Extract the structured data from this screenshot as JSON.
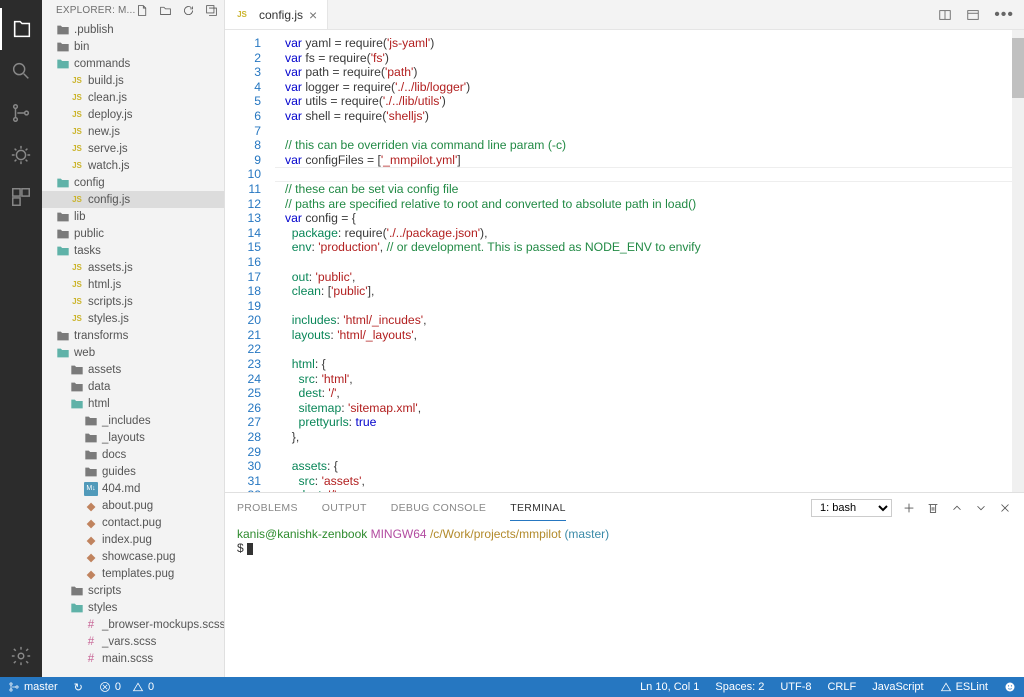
{
  "sidebar": {
    "title": "EXPLORER: M...",
    "tree": [
      {
        "d": 0,
        "t": "folder",
        "open": false,
        "n": ".publish"
      },
      {
        "d": 0,
        "t": "folder",
        "open": false,
        "n": "bin"
      },
      {
        "d": 0,
        "t": "folder",
        "open": true,
        "n": "commands"
      },
      {
        "d": 1,
        "t": "js",
        "n": "build.js"
      },
      {
        "d": 1,
        "t": "js",
        "n": "clean.js"
      },
      {
        "d": 1,
        "t": "js",
        "n": "deploy.js"
      },
      {
        "d": 1,
        "t": "js",
        "n": "new.js"
      },
      {
        "d": 1,
        "t": "js",
        "n": "serve.js"
      },
      {
        "d": 1,
        "t": "js",
        "n": "watch.js"
      },
      {
        "d": 0,
        "t": "folder",
        "open": true,
        "n": "config"
      },
      {
        "d": 1,
        "t": "js",
        "n": "config.js",
        "sel": true
      },
      {
        "d": 0,
        "t": "folder",
        "open": false,
        "n": "lib"
      },
      {
        "d": 0,
        "t": "folder",
        "open": false,
        "n": "public"
      },
      {
        "d": 0,
        "t": "folder",
        "open": true,
        "n": "tasks"
      },
      {
        "d": 1,
        "t": "js",
        "n": "assets.js"
      },
      {
        "d": 1,
        "t": "js",
        "n": "html.js"
      },
      {
        "d": 1,
        "t": "js",
        "n": "scripts.js"
      },
      {
        "d": 1,
        "t": "js",
        "n": "styles.js"
      },
      {
        "d": 0,
        "t": "folder",
        "open": false,
        "n": "transforms"
      },
      {
        "d": 0,
        "t": "folder",
        "open": true,
        "n": "web"
      },
      {
        "d": 1,
        "t": "folder",
        "open": false,
        "n": "assets"
      },
      {
        "d": 1,
        "t": "folder",
        "open": false,
        "n": "data"
      },
      {
        "d": 1,
        "t": "folder",
        "open": true,
        "n": "html"
      },
      {
        "d": 2,
        "t": "folder",
        "open": false,
        "n": "_includes"
      },
      {
        "d": 2,
        "t": "folder",
        "open": false,
        "n": "_layouts"
      },
      {
        "d": 2,
        "t": "folder",
        "open": false,
        "n": "docs"
      },
      {
        "d": 2,
        "t": "folder",
        "open": false,
        "n": "guides"
      },
      {
        "d": 2,
        "t": "md",
        "n": "404.md"
      },
      {
        "d": 2,
        "t": "pug",
        "n": "about.pug"
      },
      {
        "d": 2,
        "t": "pug",
        "n": "contact.pug"
      },
      {
        "d": 2,
        "t": "pug",
        "n": "index.pug"
      },
      {
        "d": 2,
        "t": "pug",
        "n": "showcase.pug"
      },
      {
        "d": 2,
        "t": "pug",
        "n": "templates.pug"
      },
      {
        "d": 1,
        "t": "folder",
        "open": false,
        "n": "scripts"
      },
      {
        "d": 1,
        "t": "folder",
        "open": true,
        "n": "styles"
      },
      {
        "d": 2,
        "t": "scss",
        "n": "_browser-mockups.scss"
      },
      {
        "d": 2,
        "t": "scss",
        "n": "_vars.scss"
      },
      {
        "d": 2,
        "t": "scss",
        "n": "main.scss"
      }
    ]
  },
  "tabs": [
    {
      "icon": "js",
      "name": "config.js"
    }
  ],
  "code": {
    "lines": [
      [
        [
          "k",
          "var"
        ],
        [
          "d",
          " yaml = require("
        ],
        [
          "s",
          "'js-yaml'"
        ],
        [
          "d",
          ")"
        ]
      ],
      [
        [
          "k",
          "var"
        ],
        [
          "d",
          " fs = require("
        ],
        [
          "s",
          "'fs'"
        ],
        [
          "d",
          ")"
        ]
      ],
      [
        [
          "k",
          "var"
        ],
        [
          "d",
          " path = require("
        ],
        [
          "s",
          "'path'"
        ],
        [
          "d",
          ")"
        ]
      ],
      [
        [
          "k",
          "var"
        ],
        [
          "d",
          " logger = require("
        ],
        [
          "s",
          "'./../lib/logger'"
        ],
        [
          "d",
          ")"
        ]
      ],
      [
        [
          "k",
          "var"
        ],
        [
          "d",
          " utils = require("
        ],
        [
          "s",
          "'./../lib/utils'"
        ],
        [
          "d",
          ")"
        ]
      ],
      [
        [
          "k",
          "var"
        ],
        [
          "d",
          " shell = require("
        ],
        [
          "s",
          "'shelljs'"
        ],
        [
          "d",
          ")"
        ]
      ],
      [],
      [
        [
          "c",
          "// this can be overriden via command line param (-c)"
        ]
      ],
      [
        [
          "k",
          "var"
        ],
        [
          "d",
          " configFiles = ["
        ],
        [
          "s",
          "'_mmpilot.yml'"
        ],
        [
          "d",
          "]"
        ]
      ],
      [],
      [
        [
          "c",
          "// these can be set via config file"
        ]
      ],
      [
        [
          "c",
          "// paths are specified relative to root and converted to absolute path in load()"
        ]
      ],
      [
        [
          "k",
          "var"
        ],
        [
          "d",
          " config = {"
        ]
      ],
      [
        [
          "d",
          "  "
        ],
        [
          "p",
          "package"
        ],
        [
          "d",
          ": require("
        ],
        [
          "s",
          "'./../package.json'"
        ],
        [
          "d",
          "),"
        ]
      ],
      [
        [
          "d",
          "  "
        ],
        [
          "p",
          "env"
        ],
        [
          "d",
          ": "
        ],
        [
          "s",
          "'production'"
        ],
        [
          "d",
          ", "
        ],
        [
          "c",
          "// or development. This is passed as NODE_ENV to envify"
        ]
      ],
      [],
      [
        [
          "d",
          "  "
        ],
        [
          "p",
          "out"
        ],
        [
          "d",
          ": "
        ],
        [
          "s",
          "'public'"
        ],
        [
          "d",
          ","
        ]
      ],
      [
        [
          "d",
          "  "
        ],
        [
          "p",
          "clean"
        ],
        [
          "d",
          ": ["
        ],
        [
          "s",
          "'public'"
        ],
        [
          "d",
          "],"
        ]
      ],
      [],
      [
        [
          "d",
          "  "
        ],
        [
          "p",
          "includes"
        ],
        [
          "d",
          ": "
        ],
        [
          "s",
          "'html/_incudes'"
        ],
        [
          "d",
          ","
        ]
      ],
      [
        [
          "d",
          "  "
        ],
        [
          "p",
          "layouts"
        ],
        [
          "d",
          ": "
        ],
        [
          "s",
          "'html/_layouts'"
        ],
        [
          "d",
          ","
        ]
      ],
      [],
      [
        [
          "d",
          "  "
        ],
        [
          "p",
          "html"
        ],
        [
          "d",
          ": {"
        ]
      ],
      [
        [
          "d",
          "    "
        ],
        [
          "p",
          "src"
        ],
        [
          "d",
          ": "
        ],
        [
          "s",
          "'html'"
        ],
        [
          "d",
          ","
        ]
      ],
      [
        [
          "d",
          "    "
        ],
        [
          "p",
          "dest"
        ],
        [
          "d",
          ": "
        ],
        [
          "s",
          "'/'"
        ],
        [
          "d",
          ","
        ]
      ],
      [
        [
          "d",
          "    "
        ],
        [
          "p",
          "sitemap"
        ],
        [
          "d",
          ": "
        ],
        [
          "s",
          "'sitemap.xml'"
        ],
        [
          "d",
          ","
        ]
      ],
      [
        [
          "d",
          "    "
        ],
        [
          "p",
          "prettyurls"
        ],
        [
          "d",
          ": "
        ],
        [
          "k",
          "true"
        ]
      ],
      [
        [
          "d",
          "  },"
        ]
      ],
      [],
      [
        [
          "d",
          "  "
        ],
        [
          "p",
          "assets"
        ],
        [
          "d",
          ": {"
        ]
      ],
      [
        [
          "d",
          "    "
        ],
        [
          "p",
          "src"
        ],
        [
          "d",
          ": "
        ],
        [
          "s",
          "'assets'"
        ],
        [
          "d",
          ","
        ]
      ],
      [
        [
          "d",
          "    "
        ],
        [
          "p",
          "dest"
        ],
        [
          "d",
          ": "
        ],
        [
          "s",
          "'/'"
        ]
      ]
    ],
    "currentLine": 10
  },
  "panel": {
    "tabs": [
      "PROBLEMS",
      "OUTPUT",
      "DEBUG CONSOLE",
      "TERMINAL"
    ],
    "active": "TERMINAL",
    "selector": "1: bash",
    "prompt": {
      "user": "kanis@kanishk-zenbook",
      "host": "MINGW64",
      "path": "/c/Work/projects/mmpilot",
      "branch": "(master)",
      "ps": "$"
    }
  },
  "status": {
    "branch": "master",
    "sync": "↻",
    "errors": "0",
    "warnings": "0",
    "pos": "Ln 10, Col 1",
    "spaces": "Spaces: 2",
    "enc": "UTF-8",
    "eol": "CRLF",
    "lang": "JavaScript",
    "linter": "ESLint"
  }
}
